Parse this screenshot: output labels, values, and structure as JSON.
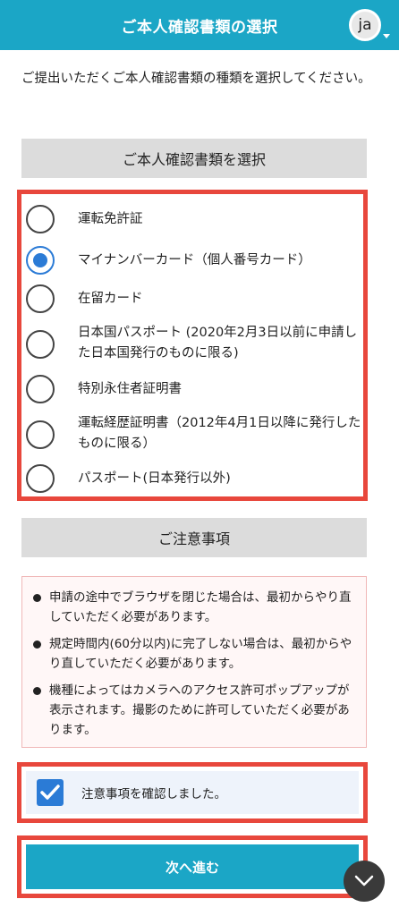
{
  "header": {
    "title": "ご本人確認書類の選択",
    "lang": "ja"
  },
  "intro": "ご提出いただくご本人確認書類の種類を選択してください。",
  "doc_section": {
    "title": "ご本人確認書類を選択",
    "options": [
      {
        "label": "運転免許証",
        "selected": false
      },
      {
        "label": "マイナンバーカード（個人番号カード）",
        "selected": true
      },
      {
        "label": "在留カード",
        "selected": false
      },
      {
        "label": "日本国パスポート (2020年2月3日以前に申請した日本国発行のものに限る)",
        "selected": false
      },
      {
        "label": "特別永住者証明書",
        "selected": false
      },
      {
        "label": "運転経歴証明書（2012年4月1日以降に発行したものに限る）",
        "selected": false
      },
      {
        "label": "パスポート(日本発行以外)",
        "selected": false
      }
    ]
  },
  "notice_section": {
    "title": "ご注意事項",
    "items": [
      "申請の途中でブラウザを閉じた場合は、最初からやり直していただく必要があります。",
      "規定時間内(60分以内)に完了しない場合は、最初からやり直していただく必要があります。",
      "機種によってはカメラへのアクセス許可ポップアップが表示されます。撮影のために許可していただく必要があります。"
    ]
  },
  "confirm": {
    "label": "注意事項を確認しました。",
    "checked": true
  },
  "next_button": {
    "label": "次へ進む"
  },
  "colors": {
    "header": "#1ba6c6",
    "accent": "#2b7bd6",
    "highlight": "#e8473c"
  },
  "icons": {
    "checkbox": "check-icon",
    "scroll": "chevron-down-icon"
  }
}
